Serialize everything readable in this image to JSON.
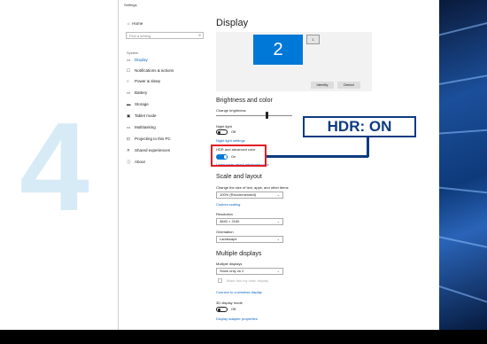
{
  "slide": {
    "step_number": "4",
    "callout_text": "HDR: ON"
  },
  "window": {
    "title": "Settings"
  },
  "sidebar": {
    "home": "Home",
    "search_placeholder": "Find a setting",
    "category": "System",
    "items": [
      {
        "label": "Display",
        "icon": "display-icon",
        "active": true
      },
      {
        "label": "Notifications & actions",
        "icon": "notifications-icon"
      },
      {
        "label": "Power & sleep",
        "icon": "power-icon"
      },
      {
        "label": "Battery",
        "icon": "battery-icon"
      },
      {
        "label": "Storage",
        "icon": "storage-icon"
      },
      {
        "label": "Tablet mode",
        "icon": "tablet-icon"
      },
      {
        "label": "Multitasking",
        "icon": "multitasking-icon"
      },
      {
        "label": "Projecting to this PC",
        "icon": "projecting-icon"
      },
      {
        "label": "Shared experiences",
        "icon": "shared-icon"
      },
      {
        "label": "About",
        "icon": "info-icon"
      }
    ]
  },
  "display": {
    "title": "Display",
    "monitor_primary": "2",
    "monitor_secondary": "1",
    "identify_label": "Identify",
    "detect_label": "Detect",
    "brightness_heading": "Brightness and color",
    "change_brightness_label": "Change brightness",
    "night_light_label": "Night light",
    "night_light_state": "Off",
    "night_light_settings_link": "Night light settings",
    "hdr_label": "HDR and advanced color",
    "hdr_state": "On",
    "hdr_link": "Learn more about advanced color",
    "scale_heading": "Scale and layout",
    "scale_label": "Change the size of text, apps, and other items",
    "scale_value": "100% (Recommended)",
    "custom_scaling_link": "Custom scaling",
    "resolution_label": "Resolution",
    "resolution_value": "3840 × 2160",
    "orientation_label": "Orientation",
    "orientation_value": "Landscape",
    "multiple_heading": "Multiple displays",
    "multiple_label": "Multiple displays",
    "multiple_value": "Show only on 2",
    "main_display_checkbox": "Make this my main display",
    "wireless_link": "Connect to a wireless display",
    "display_3d_label": "3D display mode",
    "display_3d_state": "Off",
    "adapter_link": "Display adapter properties"
  },
  "colors": {
    "accent": "#0078d7",
    "highlight_red": "#e31b23",
    "callout_navy": "#0d3b80",
    "step_number": "#d7ebf6"
  }
}
